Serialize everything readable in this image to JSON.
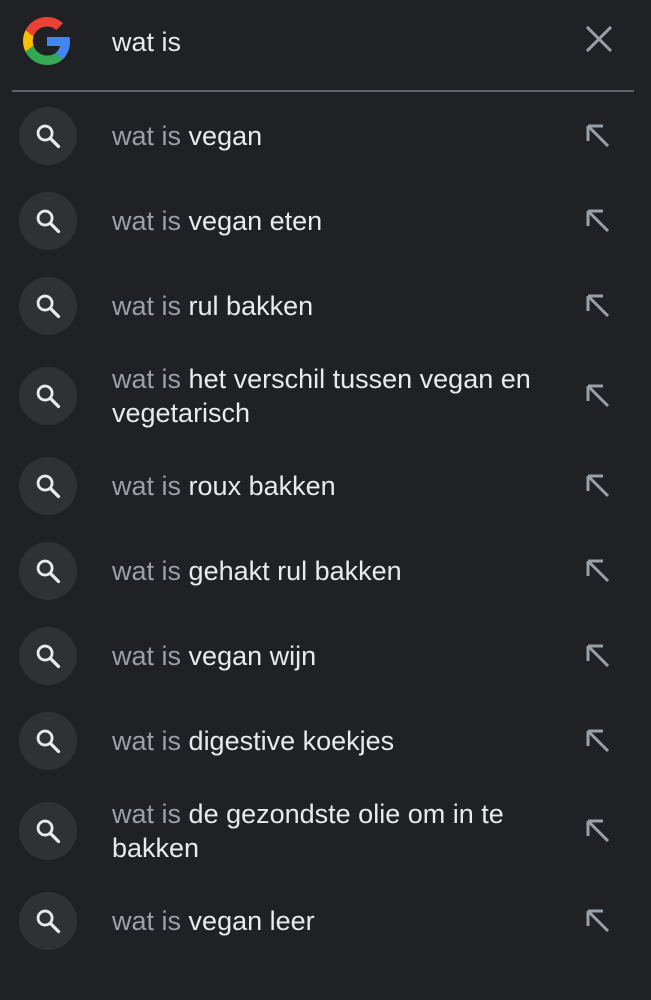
{
  "search": {
    "query": "wat is",
    "logo_icon": "google-g-logo",
    "clear_icon": "close-icon"
  },
  "suggestions": [
    {
      "prefix": "wat is",
      "completion": "vegan"
    },
    {
      "prefix": "wat is",
      "completion": "vegan eten"
    },
    {
      "prefix": "wat is",
      "completion": "rul bakken"
    },
    {
      "prefix": "wat is",
      "completion": "het verschil tussen vegan en vegetarisch"
    },
    {
      "prefix": "wat is",
      "completion": "roux bakken"
    },
    {
      "prefix": "wat is",
      "completion": "gehakt rul bakken"
    },
    {
      "prefix": "wat is",
      "completion": "vegan wijn"
    },
    {
      "prefix": "wat is",
      "completion": "digestive koekjes"
    },
    {
      "prefix": "wat is",
      "completion": "de gezondste olie om in te bakken"
    },
    {
      "prefix": "wat is",
      "completion": "vegan leer"
    }
  ],
  "icons": {
    "suggestion_icon": "search-icon",
    "fill_icon": "arrow-up-left-icon"
  },
  "colors": {
    "background": "#202124",
    "text": "#e8eaed",
    "prefix_text": "#9aa0a6",
    "icon_circle": "#303134",
    "divider": "#5f6368"
  }
}
